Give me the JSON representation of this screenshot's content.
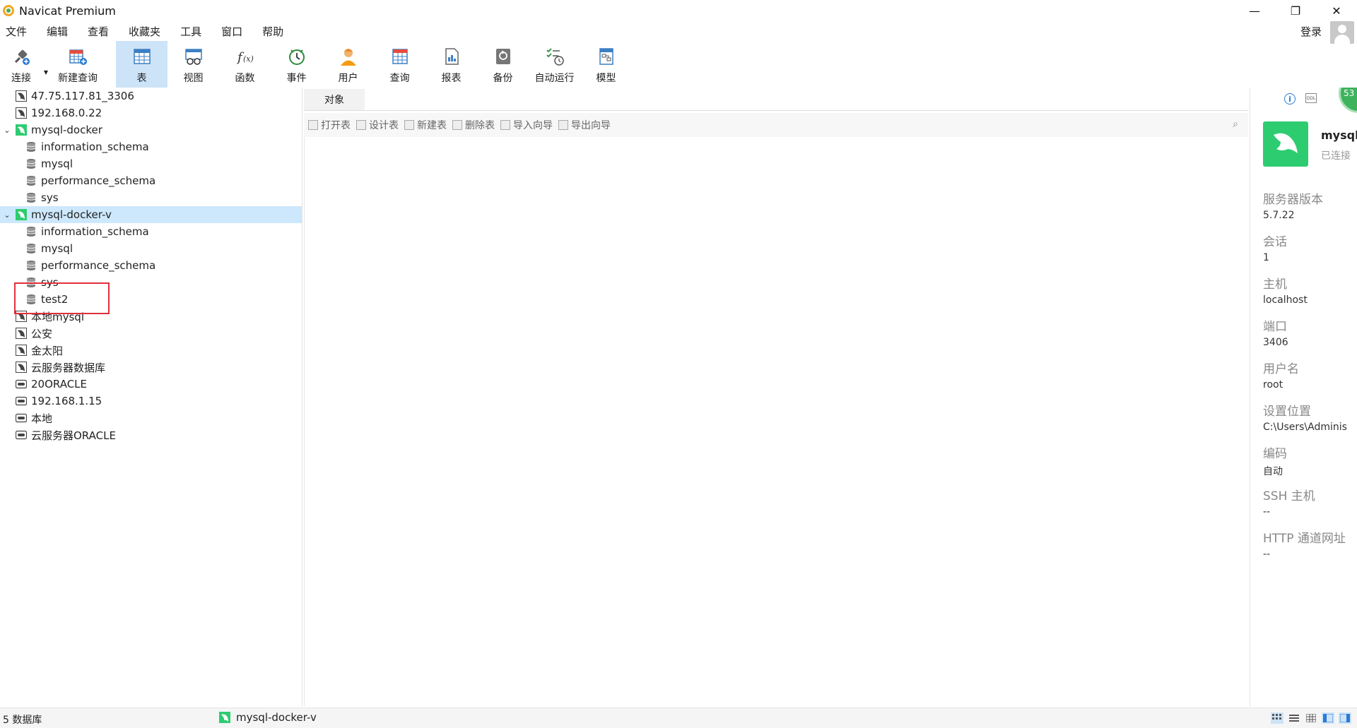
{
  "window": {
    "title": "Navicat Premium",
    "controls": [
      "minimize-icon",
      "restore-icon",
      "close-icon"
    ]
  },
  "menu": {
    "items": [
      "文件",
      "编辑",
      "查看",
      "收藏夹",
      "工具",
      "窗口",
      "帮助"
    ],
    "login": "登录"
  },
  "toolbar": {
    "items": [
      {
        "label": "连接",
        "icon": "connect-plug-icon"
      },
      {
        "label": "新建查询",
        "icon": "new-query-icon"
      },
      {
        "label": "表",
        "icon": "table-icon",
        "active": true
      },
      {
        "label": "视图",
        "icon": "view-icon"
      },
      {
        "label": "函数",
        "icon": "function-icon"
      },
      {
        "label": "事件",
        "icon": "event-clock-icon"
      },
      {
        "label": "用户",
        "icon": "user-icon"
      },
      {
        "label": "查询",
        "icon": "query-icon"
      },
      {
        "label": "报表",
        "icon": "report-icon"
      },
      {
        "label": "备份",
        "icon": "backup-icon"
      },
      {
        "label": "自动运行",
        "icon": "auto-run-icon"
      },
      {
        "label": "模型",
        "icon": "model-icon"
      }
    ]
  },
  "tree": {
    "rows": [
      {
        "label": "47.75.117.81_3306",
        "kind": "mysql-off",
        "level": 0
      },
      {
        "label": "192.168.0.22",
        "kind": "mysql-off",
        "level": 0
      },
      {
        "label": "mysql-docker",
        "kind": "mysql-on",
        "level": 0,
        "expanded": true
      },
      {
        "label": "information_schema",
        "kind": "db",
        "level": 1
      },
      {
        "label": "mysql",
        "kind": "db",
        "level": 1
      },
      {
        "label": "performance_schema",
        "kind": "db",
        "level": 1
      },
      {
        "label": "sys",
        "kind": "db",
        "level": 1
      },
      {
        "label": "mysql-docker-v",
        "kind": "mysql-on",
        "level": 0,
        "expanded": true,
        "selected": true
      },
      {
        "label": "information_schema",
        "kind": "db",
        "level": 1
      },
      {
        "label": "mysql",
        "kind": "db",
        "level": 1
      },
      {
        "label": "performance_schema",
        "kind": "db",
        "level": 1
      },
      {
        "label": "sys",
        "kind": "db",
        "level": 1
      },
      {
        "label": "test2",
        "kind": "db",
        "level": 1
      },
      {
        "label": "本地mysql",
        "kind": "mysql-off",
        "level": 0
      },
      {
        "label": "公安",
        "kind": "mysql-off",
        "level": 0
      },
      {
        "label": "金太阳",
        "kind": "mysql-off",
        "level": 0
      },
      {
        "label": "云服务器数据库",
        "kind": "mysql-off",
        "level": 0
      },
      {
        "label": "20ORACLE",
        "kind": "oracle",
        "level": 0
      },
      {
        "label": "192.168.1.15",
        "kind": "oracle",
        "level": 0
      },
      {
        "label": "本地",
        "kind": "oracle",
        "level": 0
      },
      {
        "label": "云服务器ORACLE",
        "kind": "oracle",
        "level": 0
      }
    ]
  },
  "center": {
    "tab": "对象",
    "actions": [
      "打开表",
      "设计表",
      "新建表",
      "删除表",
      "导入向导",
      "导出向导"
    ]
  },
  "info": {
    "badge": "53",
    "conn_name": "mysql",
    "conn_status": "已连接",
    "items": [
      {
        "key": "服务器版本",
        "value": "5.7.22"
      },
      {
        "key": "会话",
        "value": "1"
      },
      {
        "key": "主机",
        "value": "localhost"
      },
      {
        "key": "端口",
        "value": "3406"
      },
      {
        "key": "用户名",
        "value": "root"
      },
      {
        "key": "设置位置",
        "value": "C:\\Users\\Adminis"
      },
      {
        "key": "编码",
        "value": "自动"
      },
      {
        "key": "SSH 主机",
        "value": "--"
      },
      {
        "key": "HTTP 通道网址",
        "value": "--"
      }
    ]
  },
  "status": {
    "count": "5 数据库",
    "conn": "mysql-docker-v"
  },
  "colors": {
    "accent": "#cde3f7",
    "selected_row": "#cde8fc",
    "mysql_green": "#2ecc71",
    "highlight_red": "#e0303a"
  }
}
